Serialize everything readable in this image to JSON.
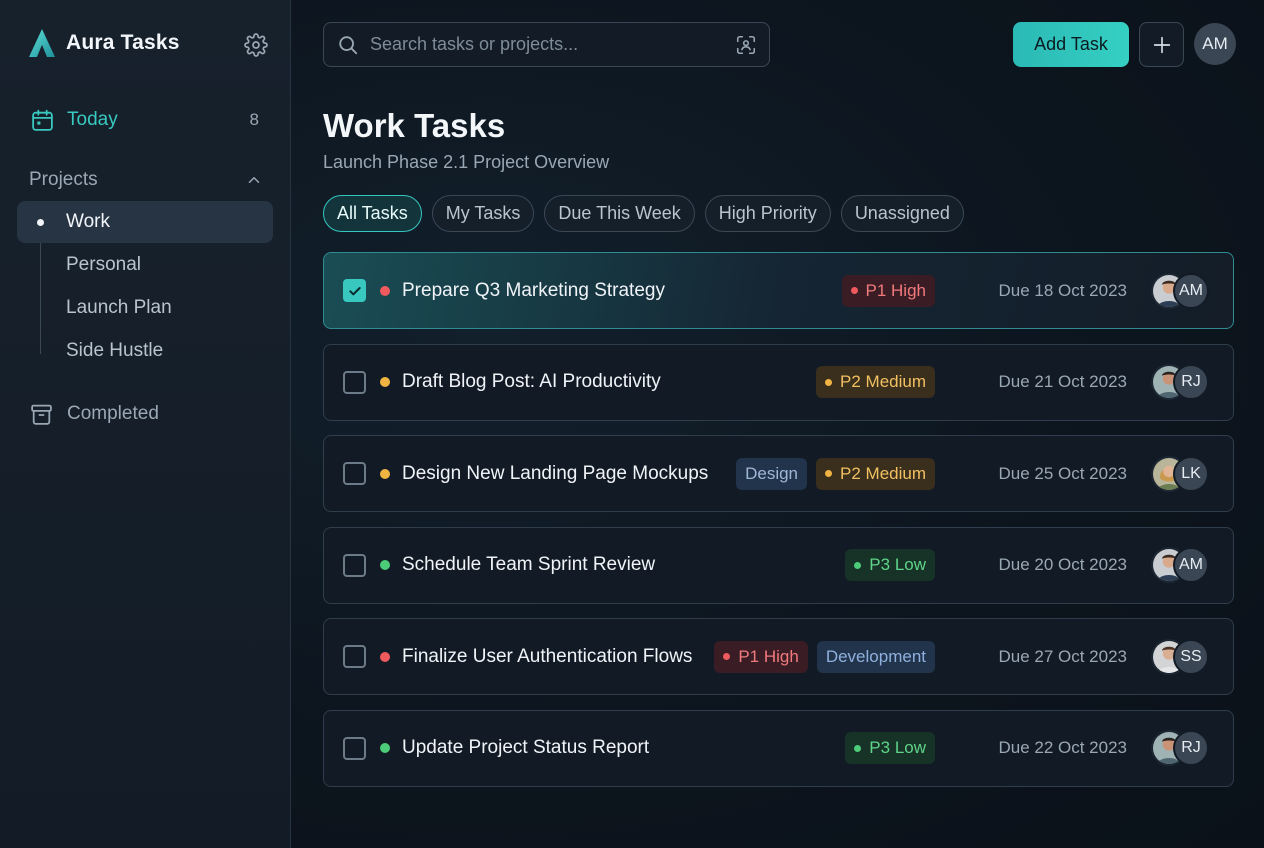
{
  "app": {
    "name": "Aura Tasks"
  },
  "colors": {
    "accent": "#38c8c0",
    "p1": "#ef5a5e",
    "p2": "#f0b443",
    "p3": "#4ccb78"
  },
  "sidebar": {
    "today": {
      "label": "Today",
      "count": "8",
      "icon": "calendar-icon"
    },
    "projects": {
      "label": "Projects",
      "items": [
        {
          "label": "Work",
          "active": true
        },
        {
          "label": "Personal"
        },
        {
          "label": "Launch Plan"
        },
        {
          "label": "Side Hustle"
        }
      ]
    },
    "completed": {
      "label": "Completed",
      "icon": "archive-icon"
    }
  },
  "header": {
    "search_placeholder": "Search tasks or projects...",
    "add_task_label": "Add Task",
    "user_initials": "AM"
  },
  "page": {
    "title": "Work Tasks",
    "subtitle": "Launch Phase 2.1 Project Overview"
  },
  "filters": [
    "All Tasks",
    "My Tasks",
    "Due This Week",
    "High Priority",
    "Unassigned"
  ],
  "tasks": [
    {
      "title": "Prepare Q3 Marketing Strategy",
      "checked": true,
      "priority_color": "#ef5a5e",
      "tags": [
        {
          "label": "P1 High"
        }
      ],
      "due": "Due 18 Oct 2023",
      "assignee": "AM"
    },
    {
      "title": "Draft Blog Post: AI Productivity",
      "checked": false,
      "priority_color": "#f0b443",
      "tags": [
        {
          "label": "P2 Medium"
        }
      ],
      "due": "Due 21 Oct 2023",
      "assignee": "RJ"
    },
    {
      "title": "Design New Landing Page Mockups",
      "checked": false,
      "priority_color": "#f0b443",
      "tags": [
        {
          "label": "Design"
        },
        {
          "label": "P2 Medium"
        }
      ],
      "due": "Due 25 Oct 2023",
      "assignee": "LK"
    },
    {
      "title": "Schedule Team Sprint Review",
      "checked": false,
      "priority_color": "#4ccb78",
      "tags": [
        {
          "label": "P3 Low"
        }
      ],
      "due": "Due 20 Oct 2023",
      "assignee": "AM"
    },
    {
      "title": "Finalize User Authentication Flows",
      "checked": false,
      "priority_color": "#ef5a5e",
      "tags": [
        {
          "label": "P1 High"
        },
        {
          "label": "Development"
        }
      ],
      "due": "Due 27 Oct 2023",
      "assignee": "SS"
    },
    {
      "title": "Update Project Status Report",
      "checked": false,
      "priority_color": "#4ccb78",
      "tags": [
        {
          "label": "P3 Low"
        }
      ],
      "due": "Due 22 Oct 2023",
      "assignee": "RJ"
    }
  ]
}
